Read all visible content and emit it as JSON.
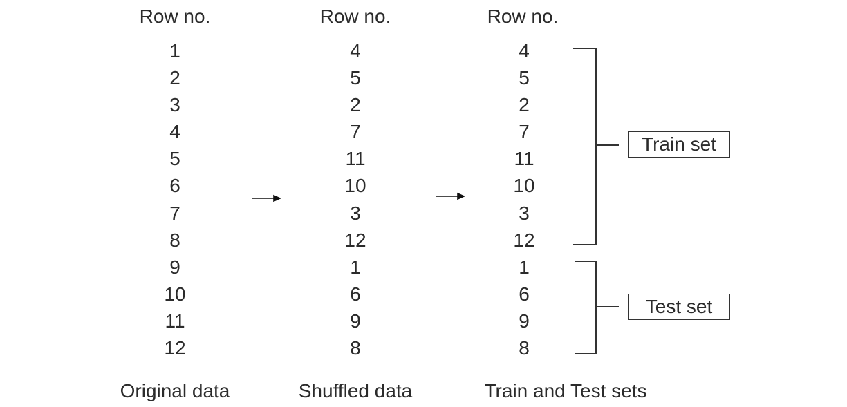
{
  "columns": [
    {
      "header": "Row no.",
      "rows": [
        "1",
        "2",
        "3",
        "4",
        "5",
        "6",
        "7",
        "8",
        "9",
        "10",
        "11",
        "12"
      ],
      "caption": "Original data"
    },
    {
      "header": "Row no.",
      "rows": [
        "4",
        "5",
        "2",
        "7",
        "11",
        "10",
        "3",
        "12",
        "1",
        "6",
        "9",
        "8"
      ],
      "caption": "Shuffled data"
    },
    {
      "header": "Row no.",
      "rows": [
        "4",
        "5",
        "2",
        "7",
        "11",
        "10",
        "3",
        "12",
        "1",
        "6",
        "9",
        "8"
      ],
      "caption": "Train and Test sets"
    }
  ],
  "groups": {
    "train": "Train set",
    "test": "Test set"
  }
}
